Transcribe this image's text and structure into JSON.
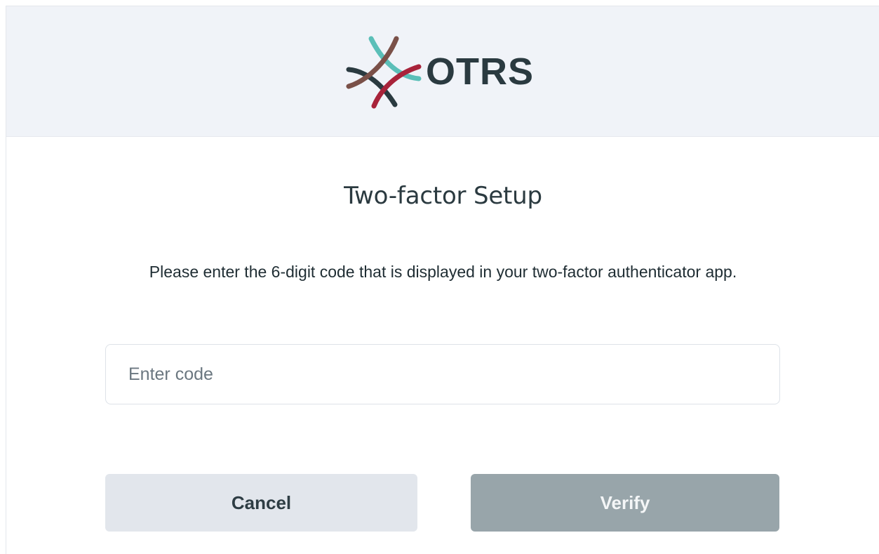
{
  "header": {
    "logo_text": "OTRS",
    "logo_icon": "otrs-star-icon",
    "background_color": "#f0f3f8"
  },
  "dialog": {
    "title": "Two-factor Setup",
    "instructions": "Please enter the 6-digit code that is displayed in your two-factor authenticator app.",
    "code_input": {
      "value": "",
      "placeholder": "Enter code"
    },
    "cancel_label": "Cancel",
    "verify_label": "Verify"
  },
  "colors": {
    "logo_teal": "#5bbfb8",
    "logo_brown": "#7a5048",
    "logo_red": "#a8233a",
    "logo_dark": "#2a3a40",
    "verify_button": "#98a5aa",
    "cancel_button": "#e2e6ec"
  }
}
